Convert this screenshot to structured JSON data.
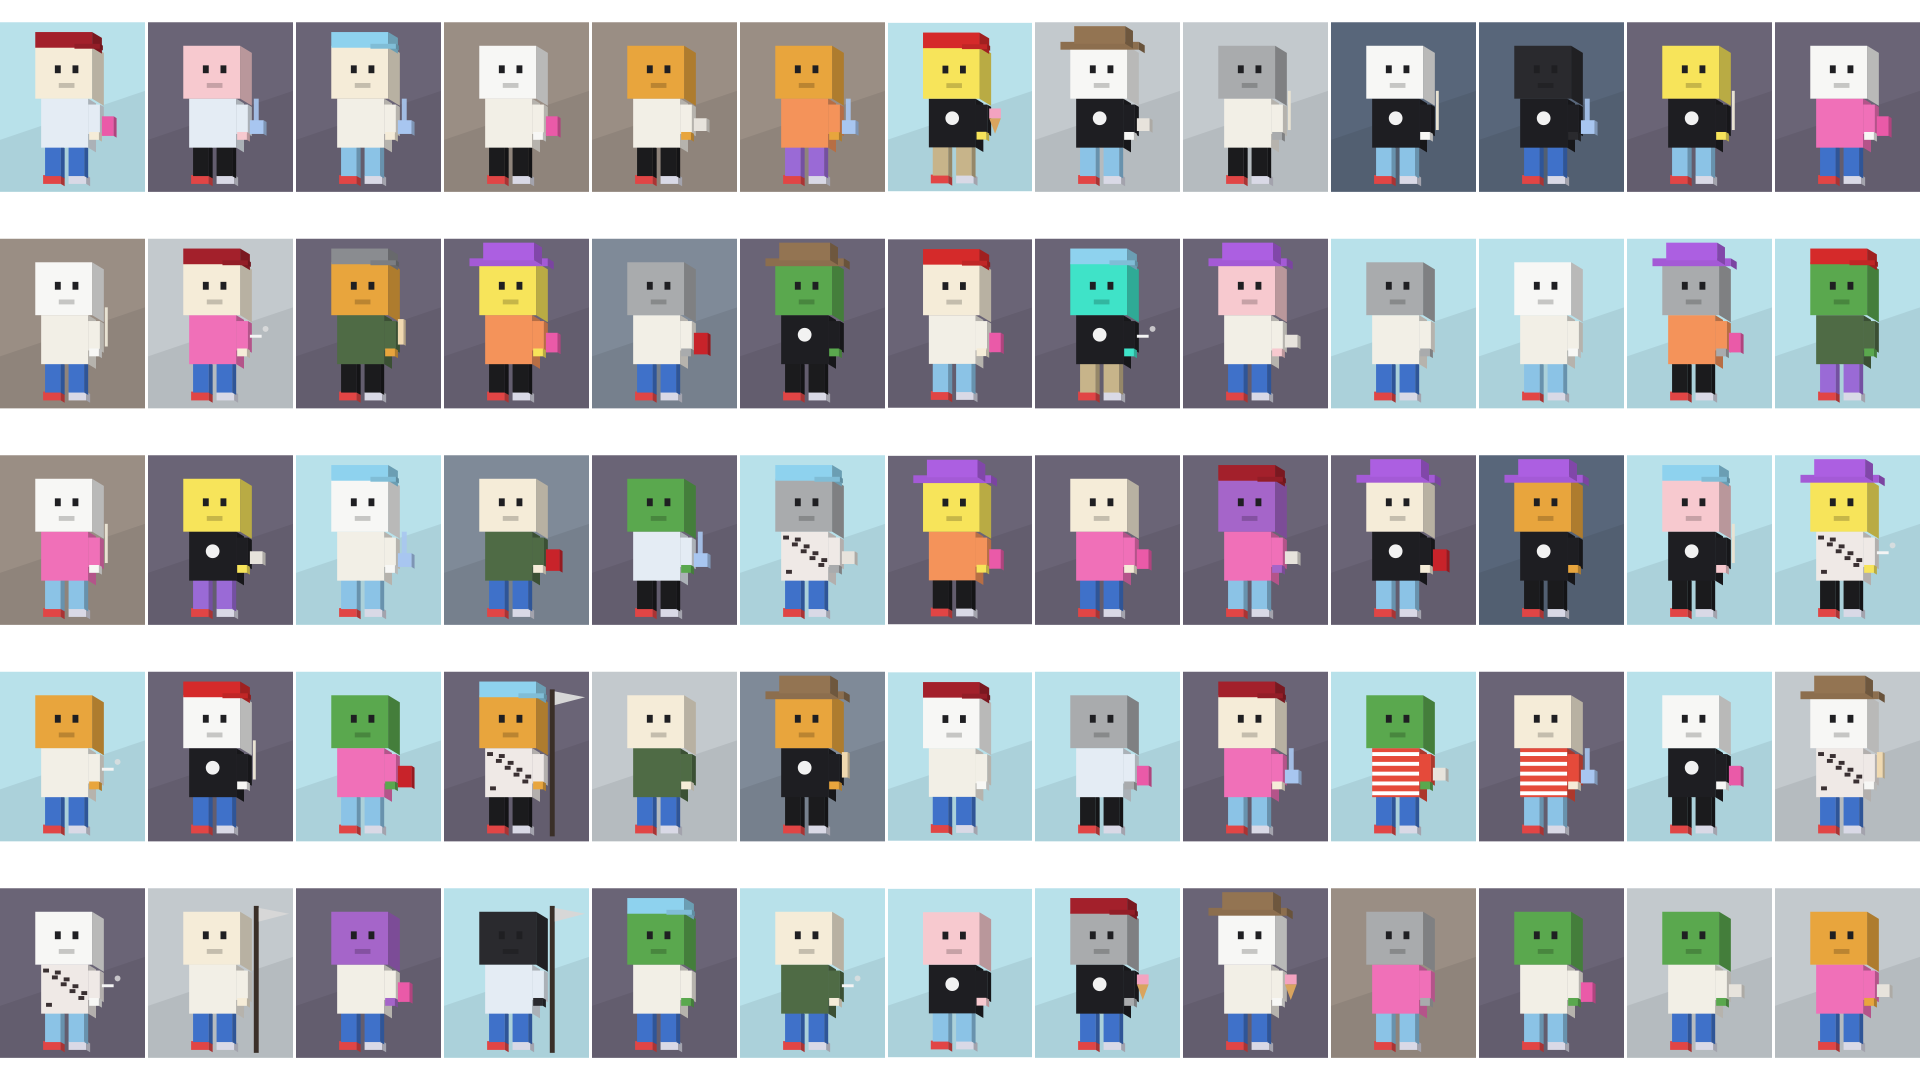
{
  "grid": {
    "columns": 13,
    "rows": 5
  },
  "palette": {
    "backgrounds": {
      "L": "#b8e1ea",
      "G": "#c3c9cd",
      "P": "#6a6476",
      "B": "#7f8a98",
      "T": "#9a8e84",
      "S": "#58667a"
    },
    "skins": {
      "cream": "#f5ecd8",
      "white": "#f7f7f5",
      "pink": "#f7c9cf",
      "yellow": "#f7e45a",
      "orange": "#e8a53d",
      "gray": "#a9abad",
      "black": "#2a2a2e",
      "green": "#5aa84e",
      "purple": "#a565c9",
      "teal": "#3fe3c8"
    },
    "shirts": {
      "white": "#f2efe6",
      "lightblue": "#e4ecf4",
      "pink": "#f070b8",
      "black": "#1e1e22",
      "orange": "#f4935a",
      "green": "#4f6b45",
      "redstripe": "#e54a3a",
      "camo": "#efe9e6"
    },
    "pants": {
      "blue": "#3f71c9",
      "black": "#1b1b1d",
      "khaki": "#c7b48a",
      "purple": "#9a6ad6",
      "lightblue": "#8bc3e6"
    },
    "hats": {
      "red": "#d52a2a",
      "darkred": "#a3202b",
      "blue": "#8ed2ee",
      "purple": "#a45ad6",
      "brown": "#8c6e4e",
      "gray": "#8a8c90"
    }
  },
  "tiles": [
    {
      "bg": "L",
      "skin": "cream",
      "shirt": "lightblue",
      "pants": "blue",
      "hat": "darkred",
      "item": "can"
    },
    {
      "bg": "P",
      "skin": "pink",
      "shirt": "lightblue",
      "pants": "black",
      "hat": "none",
      "item": "bong"
    },
    {
      "bg": "P",
      "skin": "cream",
      "shirt": "white",
      "pants": "lightblue",
      "hat": "blue",
      "item": "bong"
    },
    {
      "bg": "T",
      "skin": "white",
      "shirt": "white",
      "pants": "black",
      "hat": "none",
      "item": "can"
    },
    {
      "bg": "T",
      "skin": "orange",
      "shirt": "white",
      "pants": "black",
      "hat": "none",
      "item": "glass"
    },
    {
      "bg": "T",
      "skin": "orange",
      "shirt": "orange",
      "pants": "purple",
      "hat": "none",
      "item": "bong"
    },
    {
      "bg": "L",
      "skin": "yellow",
      "shirt": "black",
      "pants": "khaki",
      "hat": "red",
      "item": "icecream"
    },
    {
      "bg": "G",
      "skin": "white",
      "shirt": "black",
      "pants": "lightblue",
      "hat": "brown",
      "item": "glass"
    },
    {
      "bg": "G",
      "skin": "gray",
      "shirt": "white",
      "pants": "black",
      "hat": "none",
      "item": "stick"
    },
    {
      "bg": "S",
      "skin": "white",
      "shirt": "black",
      "pants": "lightblue",
      "hat": "none",
      "item": "stick"
    },
    {
      "bg": "S",
      "skin": "black",
      "shirt": "black",
      "pants": "blue",
      "hat": "none",
      "item": "bong"
    },
    {
      "bg": "P",
      "skin": "yellow",
      "shirt": "black",
      "pants": "lightblue",
      "hat": "none",
      "item": "stick"
    },
    {
      "bg": "P",
      "skin": "white",
      "shirt": "pink",
      "pants": "blue",
      "hat": "none",
      "item": "can"
    },
    {
      "bg": "T",
      "skin": "white",
      "shirt": "white",
      "pants": "blue",
      "hat": "none",
      "item": "stick"
    },
    {
      "bg": "G",
      "skin": "cream",
      "shirt": "pink",
      "pants": "blue",
      "hat": "darkred",
      "item": "smoke"
    },
    {
      "bg": "P",
      "skin": "orange",
      "shirt": "green",
      "pants": "black",
      "hat": "gray",
      "item": "bone"
    },
    {
      "bg": "P",
      "skin": "yellow",
      "shirt": "orange",
      "pants": "black",
      "hat": "purple",
      "item": "can"
    },
    {
      "bg": "B",
      "skin": "gray",
      "shirt": "white",
      "pants": "blue",
      "hat": "none",
      "item": "dynamite"
    },
    {
      "bg": "P",
      "skin": "green",
      "shirt": "black",
      "pants": "black",
      "hat": "brown",
      "item": "none"
    },
    {
      "bg": "P",
      "skin": "cream",
      "shirt": "white",
      "pants": "lightblue",
      "hat": "red",
      "item": "can"
    },
    {
      "bg": "P",
      "skin": "teal",
      "shirt": "black",
      "pants": "khaki",
      "hat": "blue",
      "item": "smoke"
    },
    {
      "bg": "P",
      "skin": "pink",
      "shirt": "white",
      "pants": "blue",
      "hat": "purple",
      "item": "glass"
    },
    {
      "bg": "L",
      "skin": "gray",
      "shirt": "white",
      "pants": "blue",
      "hat": "none",
      "item": "none"
    },
    {
      "bg": "L",
      "skin": "white",
      "shirt": "white",
      "pants": "lightblue",
      "hat": "none",
      "item": "none"
    },
    {
      "bg": "L",
      "skin": "gray",
      "shirt": "orange",
      "pants": "black",
      "hat": "purple",
      "item": "can"
    },
    {
      "bg": "L",
      "skin": "green",
      "shirt": "green",
      "pants": "purple",
      "hat": "red",
      "item": "none"
    },
    {
      "bg": "T",
      "skin": "white",
      "shirt": "pink",
      "pants": "lightblue",
      "hat": "none",
      "item": "stick"
    },
    {
      "bg": "P",
      "skin": "yellow",
      "shirt": "black",
      "pants": "purple",
      "hat": "none",
      "item": "glass"
    },
    {
      "bg": "L",
      "skin": "white",
      "shirt": "white",
      "pants": "lightblue",
      "hat": "blue",
      "item": "bong"
    },
    {
      "bg": "B",
      "skin": "cream",
      "shirt": "green",
      "pants": "blue",
      "hat": "none",
      "item": "dynamite"
    },
    {
      "bg": "P",
      "skin": "green",
      "shirt": "lightblue",
      "pants": "black",
      "hat": "none",
      "item": "bong"
    },
    {
      "bg": "L",
      "skin": "gray",
      "shirt": "camo",
      "pants": "blue",
      "hat": "blue",
      "item": "glass"
    },
    {
      "bg": "P",
      "skin": "yellow",
      "shirt": "orange",
      "pants": "black",
      "hat": "purple",
      "item": "can"
    },
    {
      "bg": "P",
      "skin": "cream",
      "shirt": "pink",
      "pants": "blue",
      "hat": "none",
      "item": "can"
    },
    {
      "bg": "P",
      "skin": "purple",
      "shirt": "pink",
      "pants": "lightblue",
      "hat": "darkred",
      "item": "glass"
    },
    {
      "bg": "P",
      "skin": "cream",
      "shirt": "black",
      "pants": "lightblue",
      "hat": "purple",
      "item": "dynamite"
    },
    {
      "bg": "S",
      "skin": "orange",
      "shirt": "black",
      "pants": "black",
      "hat": "purple",
      "item": "none"
    },
    {
      "bg": "L",
      "skin": "pink",
      "shirt": "black",
      "pants": "black",
      "hat": "blue",
      "item": "stick"
    },
    {
      "bg": "L",
      "skin": "yellow",
      "shirt": "camo",
      "pants": "black",
      "hat": "purple",
      "item": "smoke"
    },
    {
      "bg": "L",
      "skin": "orange",
      "shirt": "white",
      "pants": "blue",
      "hat": "none",
      "item": "smoke"
    },
    {
      "bg": "P",
      "skin": "white",
      "shirt": "black",
      "pants": "blue",
      "hat": "red",
      "item": "stick"
    },
    {
      "bg": "L",
      "skin": "green",
      "shirt": "pink",
      "pants": "lightblue",
      "hat": "none",
      "item": "dynamite"
    },
    {
      "bg": "P",
      "skin": "orange",
      "shirt": "camo",
      "pants": "black",
      "hat": "blue",
      "item": "scythe"
    },
    {
      "bg": "G",
      "skin": "cream",
      "shirt": "green",
      "pants": "blue",
      "hat": "none",
      "item": "none"
    },
    {
      "bg": "B",
      "skin": "orange",
      "shirt": "black",
      "pants": "black",
      "hat": "brown",
      "item": "bone"
    },
    {
      "bg": "L",
      "skin": "white",
      "shirt": "white",
      "pants": "blue",
      "hat": "darkred",
      "item": "none"
    },
    {
      "bg": "L",
      "skin": "gray",
      "shirt": "lightblue",
      "pants": "black",
      "hat": "none",
      "item": "can"
    },
    {
      "bg": "P",
      "skin": "cream",
      "shirt": "pink",
      "pants": "lightblue",
      "hat": "darkred",
      "item": "bong"
    },
    {
      "bg": "L",
      "skin": "green",
      "shirt": "redstripe",
      "pants": "blue",
      "hat": "none",
      "item": "glass"
    },
    {
      "bg": "P",
      "skin": "cream",
      "shirt": "redstripe",
      "pants": "lightblue",
      "hat": "none",
      "item": "bong"
    },
    {
      "bg": "L",
      "skin": "white",
      "shirt": "black",
      "pants": "black",
      "hat": "none",
      "item": "can"
    },
    {
      "bg": "G",
      "skin": "white",
      "shirt": "camo",
      "pants": "blue",
      "hat": "brown",
      "item": "bone"
    },
    {
      "bg": "P",
      "skin": "white",
      "shirt": "camo",
      "pants": "lightblue",
      "hat": "none",
      "item": "smoke"
    },
    {
      "bg": "G",
      "skin": "cream",
      "shirt": "white",
      "pants": "blue",
      "hat": "none",
      "item": "scythe"
    },
    {
      "bg": "P",
      "skin": "purple",
      "shirt": "white",
      "pants": "blue",
      "hat": "none",
      "item": "can"
    },
    {
      "bg": "L",
      "skin": "black",
      "shirt": "lightblue",
      "pants": "blue",
      "hat": "none",
      "item": "scythe"
    },
    {
      "bg": "P",
      "skin": "green",
      "shirt": "white",
      "pants": "blue",
      "hat": "blue",
      "item": "none"
    },
    {
      "bg": "L",
      "skin": "cream",
      "shirt": "green",
      "pants": "blue",
      "hat": "none",
      "item": "smoke"
    },
    {
      "bg": "L",
      "skin": "pink",
      "shirt": "black",
      "pants": "lightblue",
      "hat": "none",
      "item": "none"
    },
    {
      "bg": "L",
      "skin": "gray",
      "shirt": "black",
      "pants": "blue",
      "hat": "darkred",
      "item": "icecream"
    },
    {
      "bg": "P",
      "skin": "white",
      "shirt": "white",
      "pants": "blue",
      "hat": "brown",
      "item": "icecream"
    },
    {
      "bg": "T",
      "skin": "gray",
      "shirt": "pink",
      "pants": "lightblue",
      "hat": "none",
      "item": "none"
    },
    {
      "bg": "P",
      "skin": "green",
      "shirt": "white",
      "pants": "lightblue",
      "hat": "none",
      "item": "can"
    },
    {
      "bg": "G",
      "skin": "green",
      "shirt": "white",
      "pants": "blue",
      "hat": "none",
      "item": "glass"
    },
    {
      "bg": "G",
      "skin": "orange",
      "shirt": "pink",
      "pants": "blue",
      "hat": "none",
      "item": "glass"
    }
  ]
}
